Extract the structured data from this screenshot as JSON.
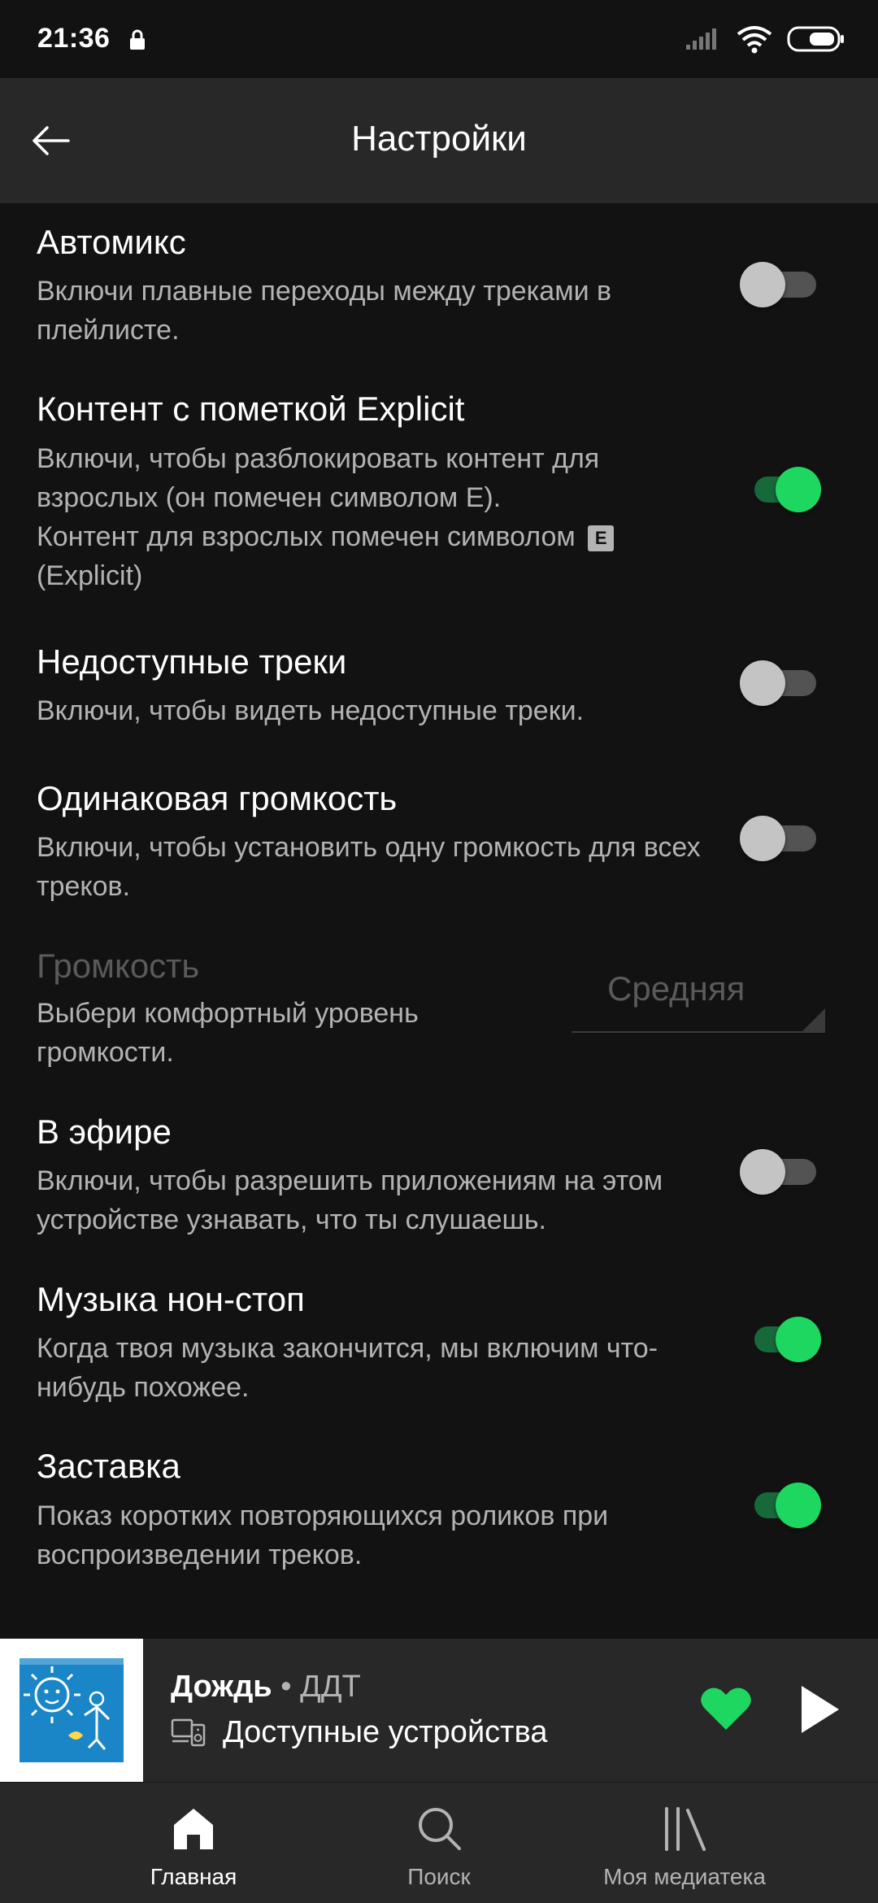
{
  "status_bar": {
    "time": "21:36",
    "icons": [
      "lock-icon",
      "signal-icon",
      "wifi-icon",
      "battery-icon"
    ]
  },
  "header": {
    "title": "Настройки",
    "back_icon": "arrow-left-icon"
  },
  "settings": [
    {
      "title": "Автомикс",
      "description": "Включи плавные переходы между треками в плейлисте.",
      "toggle": "off"
    },
    {
      "title": "Контент с пометкой Explicit",
      "description_line1": "Включи, чтобы разблокировать контент для взрослых (он помечен символом E).",
      "description_line2_before": "Контент для взрослых помечен символом",
      "badge": "E",
      "description_line2_after": "(Explicit)",
      "toggle": "on"
    },
    {
      "title": "Недоступные треки",
      "description": "Включи, чтобы видеть недоступные треки.",
      "toggle": "off"
    },
    {
      "title": "Одинаковая громкость",
      "description": "Включи, чтобы установить одну громкость для всех треков.",
      "toggle": "off"
    },
    {
      "title": "Громкость",
      "description": "Выбери комфортный уровень громкости.",
      "select_value": "Средняя",
      "disabled": true
    },
    {
      "title": "В эфире",
      "description": "Включи, чтобы разрешить приложениям на этом устройстве узнавать, что ты слушаешь.",
      "toggle": "off"
    },
    {
      "title": "Музыка нон-стоп",
      "description": "Когда твоя музыка закончится, мы включим что-нибудь похожее.",
      "toggle": "on"
    },
    {
      "title": "Заставка",
      "description": "Показ коротких повторяющихся роликов при воспроизведении треков.",
      "toggle": "on"
    }
  ],
  "player": {
    "track": "Дождь",
    "separator": "•",
    "artist": "ДДТ",
    "device_label": "Доступные устройства",
    "liked": true,
    "colors": {
      "accent": "#1ed760"
    }
  },
  "bottom_nav": [
    {
      "label": "Главная",
      "icon": "home-icon",
      "active": true
    },
    {
      "label": "Поиск",
      "icon": "search-icon",
      "active": false
    },
    {
      "label": "Моя медиатека",
      "icon": "library-icon",
      "active": false
    }
  ]
}
